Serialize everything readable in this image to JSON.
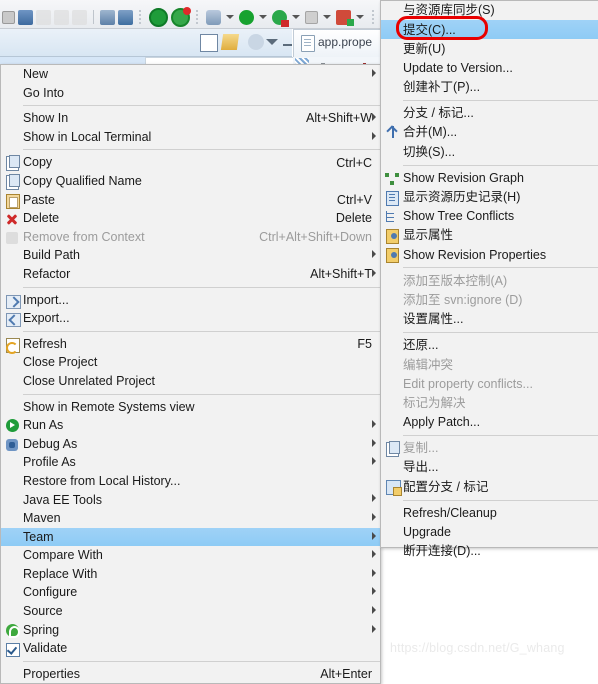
{
  "app": {
    "editor_tab": "app.prope",
    "watermark": "https://blog.csdn.net/G_whang"
  },
  "toolbar": {
    "icons": [
      "stop-icon",
      "debug-step-icon",
      "step-return-icon",
      "step-over-icon",
      "step-into-icon",
      "separator",
      "new-java-class-icon",
      "new-java-package-icon",
      "dot-separator",
      "open-type-icon",
      "progress-icon",
      "dot-separator",
      "external-tools-icon",
      "external-tools-dropdown",
      "run-icon",
      "run-dropdown",
      "debug-icon",
      "debug-dropdown",
      "terminate-icon",
      "terminate-dropdown",
      "server-icon",
      "server-dropdown",
      "dot-separator",
      "search-icon"
    ]
  },
  "view_toolbar": {
    "icons": [
      "collapse-all-icon",
      "link-with-editor-icon",
      "view-menu-icon",
      "minimize-icon",
      "maximize-icon"
    ]
  },
  "context_menu": {
    "name": "project-context-menu",
    "items": [
      {
        "label": "New",
        "icon": null,
        "accel": "",
        "submenu": true,
        "disabled": false
      },
      {
        "label": "Go Into",
        "icon": null,
        "accel": "",
        "submenu": false,
        "disabled": false
      },
      {
        "separator": true
      },
      {
        "label": "Show In",
        "icon": null,
        "accel": "Alt+Shift+W",
        "submenu": true,
        "disabled": false
      },
      {
        "label": "Show in Local Terminal",
        "icon": null,
        "accel": "",
        "submenu": true,
        "disabled": false
      },
      {
        "separator": true
      },
      {
        "label": "Copy",
        "icon": "copy-icon",
        "accel": "Ctrl+C",
        "submenu": false,
        "disabled": false
      },
      {
        "label": "Copy Qualified Name",
        "icon": "copy-qualified-name-icon",
        "accel": "",
        "submenu": false,
        "disabled": false
      },
      {
        "label": "Paste",
        "icon": "paste-icon",
        "accel": "Ctrl+V",
        "submenu": false,
        "disabled": false
      },
      {
        "label": "Delete",
        "icon": "delete-icon",
        "accel": "Delete",
        "submenu": false,
        "disabled": false
      },
      {
        "label": "Remove from Context",
        "icon": "remove-from-context-icon",
        "accel": "Ctrl+Alt+Shift+Down",
        "submenu": false,
        "disabled": true
      },
      {
        "label": "Build Path",
        "icon": null,
        "accel": "",
        "submenu": true,
        "disabled": false
      },
      {
        "label": "Refactor",
        "icon": null,
        "accel": "Alt+Shift+T",
        "submenu": true,
        "disabled": false
      },
      {
        "separator": true
      },
      {
        "label": "Import...",
        "icon": "import-icon",
        "accel": "",
        "submenu": false,
        "disabled": false
      },
      {
        "label": "Export...",
        "icon": "export-icon",
        "accel": "",
        "submenu": false,
        "disabled": false
      },
      {
        "separator": true
      },
      {
        "label": "Refresh",
        "icon": "refresh-icon",
        "accel": "F5",
        "submenu": false,
        "disabled": false
      },
      {
        "label": "Close Project",
        "icon": null,
        "accel": "",
        "submenu": false,
        "disabled": false
      },
      {
        "label": "Close Unrelated Project",
        "icon": null,
        "accel": "",
        "submenu": false,
        "disabled": false
      },
      {
        "separator": true
      },
      {
        "label": "Show in Remote Systems view",
        "icon": null,
        "accel": "",
        "submenu": false,
        "disabled": false
      },
      {
        "label": "Run As",
        "icon": "run-icon",
        "accel": "",
        "submenu": true,
        "disabled": false
      },
      {
        "label": "Debug As",
        "icon": "debug-icon",
        "accel": "",
        "submenu": true,
        "disabled": false
      },
      {
        "label": "Profile As",
        "icon": null,
        "accel": "",
        "submenu": true,
        "disabled": false
      },
      {
        "label": "Restore from Local History...",
        "icon": null,
        "accel": "",
        "submenu": false,
        "disabled": false
      },
      {
        "label": "Java EE Tools",
        "icon": null,
        "accel": "",
        "submenu": true,
        "disabled": false
      },
      {
        "label": "Maven",
        "icon": null,
        "accel": "",
        "submenu": true,
        "disabled": false
      },
      {
        "label": "Team",
        "icon": null,
        "accel": "",
        "submenu": true,
        "disabled": false,
        "selected": true
      },
      {
        "label": "Compare With",
        "icon": null,
        "accel": "",
        "submenu": true,
        "disabled": false
      },
      {
        "label": "Replace With",
        "icon": null,
        "accel": "",
        "submenu": true,
        "disabled": false
      },
      {
        "label": "Configure",
        "icon": null,
        "accel": "",
        "submenu": true,
        "disabled": false
      },
      {
        "label": "Source",
        "icon": null,
        "accel": "",
        "submenu": true,
        "disabled": false
      },
      {
        "label": "Spring",
        "icon": "spring-icon",
        "accel": "",
        "submenu": true,
        "disabled": false
      },
      {
        "label": "Validate",
        "icon": "validate-check-icon",
        "accel": "",
        "submenu": false,
        "disabled": false
      },
      {
        "separator": true
      },
      {
        "label": "Properties",
        "icon": null,
        "accel": "Alt+Enter",
        "submenu": false,
        "disabled": false
      }
    ]
  },
  "team_submenu": {
    "name": "team-submenu",
    "items": [
      {
        "label": "与资源库同步(S)",
        "icon": null,
        "submenu": false,
        "disabled": false
      },
      {
        "label": "提交(C)...",
        "icon": null,
        "submenu": false,
        "disabled": false,
        "selected": true,
        "annotated": true
      },
      {
        "label": "更新(U)",
        "icon": null,
        "submenu": false,
        "disabled": false
      },
      {
        "label": "Update to Version...",
        "icon": null,
        "submenu": false,
        "disabled": false
      },
      {
        "label": "创建补丁(P)...",
        "icon": null,
        "submenu": false,
        "disabled": false
      },
      {
        "separator": true
      },
      {
        "label": "分支 / 标记...",
        "icon": null,
        "submenu": false,
        "disabled": false
      },
      {
        "label": "合并(M)...",
        "icon": "merge-icon",
        "submenu": false,
        "disabled": false
      },
      {
        "label": "切换(S)...",
        "icon": null,
        "submenu": false,
        "disabled": false
      },
      {
        "separator": true
      },
      {
        "label": "Show Revision Graph",
        "icon": "revision-graph-icon",
        "submenu": false,
        "disabled": false
      },
      {
        "label": "显示资源历史记录(H)",
        "icon": "history-icon",
        "submenu": false,
        "disabled": false
      },
      {
        "label": "Show Tree Conflicts",
        "icon": "tree-conflicts-icon",
        "submenu": false,
        "disabled": false
      },
      {
        "label": "显示属性",
        "icon": "properties-icon",
        "submenu": false,
        "disabled": false
      },
      {
        "label": "Show Revision Properties",
        "icon": "revision-properties-icon",
        "submenu": false,
        "disabled": false
      },
      {
        "separator": true
      },
      {
        "label": "添加至版本控制(A)",
        "icon": null,
        "submenu": false,
        "disabled": true
      },
      {
        "label": "添加至 svn:ignore (D)",
        "icon": null,
        "submenu": false,
        "disabled": true
      },
      {
        "label": "设置属性...",
        "icon": null,
        "submenu": false,
        "disabled": false
      },
      {
        "separator": true
      },
      {
        "label": "还原...",
        "icon": null,
        "submenu": false,
        "disabled": false
      },
      {
        "label": "编辑冲突",
        "icon": null,
        "submenu": false,
        "disabled": true
      },
      {
        "label": "Edit property conflicts...",
        "icon": null,
        "submenu": false,
        "disabled": true
      },
      {
        "label": "标记为解决",
        "icon": null,
        "submenu": false,
        "disabled": true
      },
      {
        "label": "Apply Patch...",
        "icon": null,
        "submenu": false,
        "disabled": false
      },
      {
        "separator": true
      },
      {
        "label": "复制...",
        "icon": "copy-icon",
        "submenu": false,
        "disabled": true
      },
      {
        "label": "导出...",
        "icon": null,
        "submenu": false,
        "disabled": false
      },
      {
        "label": "配置分支 / 标记",
        "icon": "configure-branch-icon",
        "submenu": false,
        "disabled": false
      },
      {
        "separator": true
      },
      {
        "label": "Refresh/Cleanup",
        "icon": null,
        "submenu": false,
        "disabled": false
      },
      {
        "label": "Upgrade",
        "icon": null,
        "submenu": false,
        "disabled": false
      },
      {
        "label": "断开连接(D)...",
        "icon": null,
        "submenu": false,
        "disabled": false
      }
    ]
  },
  "colors": {
    "menu_bg": "#f2f2f2",
    "highlight": "#9ed3f6",
    "annotation_red": "#e80000",
    "disabled_text": "#9c9c9c"
  }
}
